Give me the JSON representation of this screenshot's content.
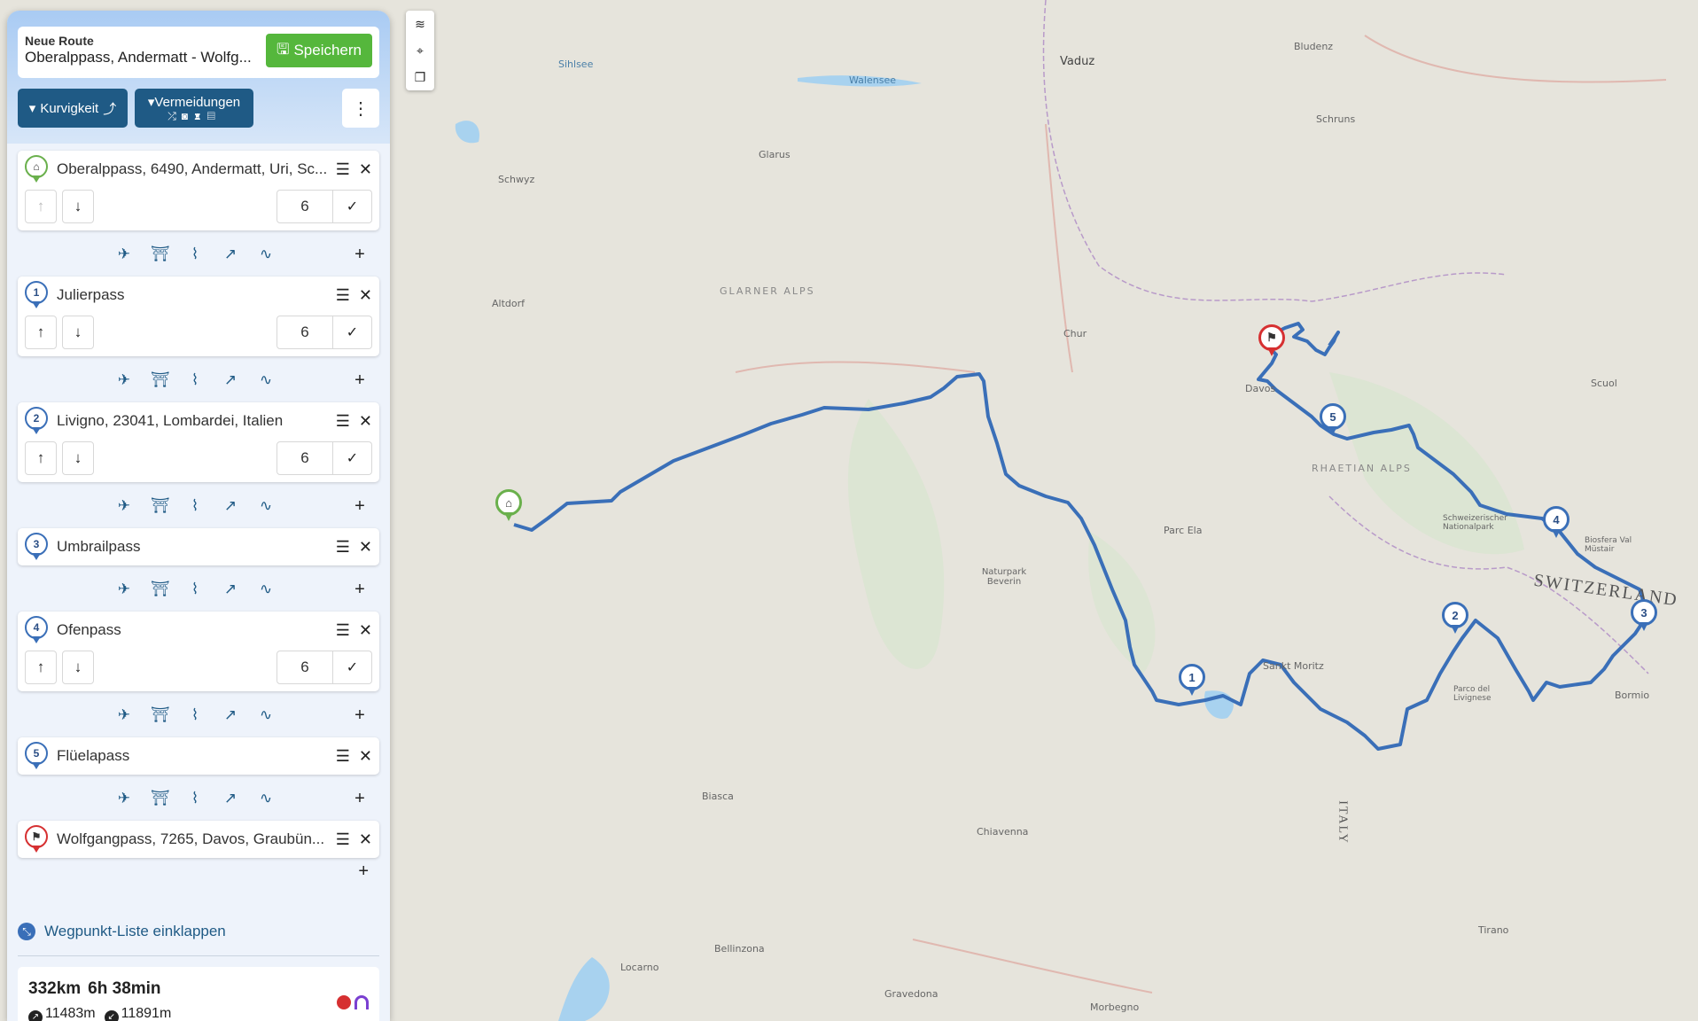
{
  "panel": {
    "route_label": "Neue Route",
    "route_name": "Oberalppass, Andermatt - Wolfg...",
    "save_label": "Speichern",
    "kurvigkeit_label": "Kurvigkeit",
    "vermeidungen_label": "Vermeidungen",
    "collapse_label": "Wegpunkt-Liste einklappen"
  },
  "waypoints": [
    {
      "marker": "",
      "name": "Oberalppass, 6490, Andermatt, Uri, Sc...",
      "value": "6",
      "type": "start"
    },
    {
      "marker": "1",
      "name": "Julierpass",
      "value": "6",
      "type": "via"
    },
    {
      "marker": "2",
      "name": "Livigno, 23041, Lombardei, Italien",
      "value": "6",
      "type": "via"
    },
    {
      "marker": "3",
      "name": "Umbrailpass",
      "value": "",
      "type": "via"
    },
    {
      "marker": "4",
      "name": "Ofenpass",
      "value": "6",
      "type": "via"
    },
    {
      "marker": "5",
      "name": "Flüelapass",
      "value": "",
      "type": "via"
    },
    {
      "marker": "",
      "name": "Wolfgangpass, 7265, Davos, Graubün...",
      "value": "",
      "type": "end"
    }
  ],
  "summary": {
    "distance": "332km",
    "duration": "6h 38min",
    "ascent": "11483m",
    "descent": "11891m"
  },
  "map": {
    "places": [
      {
        "name": "Vaduz"
      },
      {
        "name": "Bludenz"
      },
      {
        "name": "Schruns"
      },
      {
        "name": "Chur"
      },
      {
        "name": "Davos"
      },
      {
        "name": "Scuol"
      },
      {
        "name": "Glarus"
      },
      {
        "name": "Schwyz"
      },
      {
        "name": "Altdorf"
      },
      {
        "name": "Sankt Moritz"
      },
      {
        "name": "Biasca"
      },
      {
        "name": "Chiavenna"
      },
      {
        "name": "Bellinzona"
      },
      {
        "name": "Locarno"
      },
      {
        "name": "Gravedona"
      },
      {
        "name": "Morbegno"
      },
      {
        "name": "Tirano"
      },
      {
        "name": "Bormio"
      },
      {
        "name": "SWITZERLAND"
      },
      {
        "name": "ITALY"
      },
      {
        "name": "GLARNER ALPS"
      },
      {
        "name": "RHAETIAN ALPS"
      },
      {
        "name": "Parc Ela"
      },
      {
        "name": "Naturpark Beverin"
      },
      {
        "name": "Walensee"
      },
      {
        "name": "Sihlsee"
      },
      {
        "name": "Parco del Livignese"
      },
      {
        "name": "Schweizerischer Nationalpark"
      },
      {
        "name": "Biosfera Val Müstair"
      }
    ]
  },
  "colors": {
    "route": "#3a6fb8",
    "start": "#6ab04c",
    "end": "#d63031",
    "save": "#55b73c",
    "tool": "#1f5a85"
  }
}
